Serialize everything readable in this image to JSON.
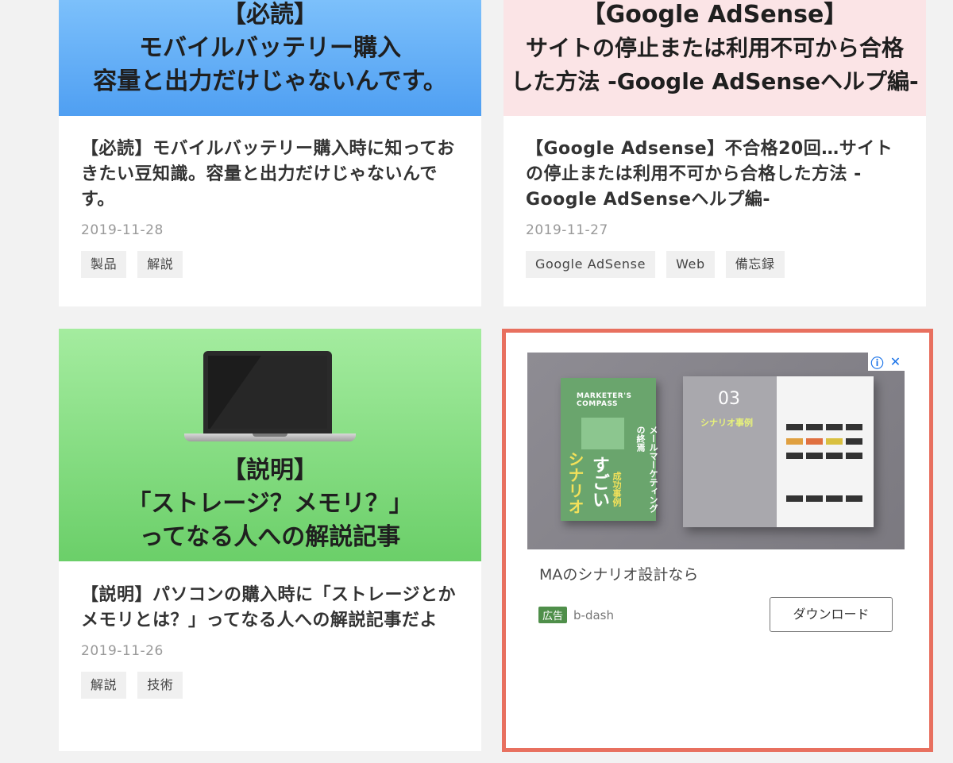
{
  "cards": [
    {
      "thumb_lines": [
        "【必読】",
        "モバイルバッテリー購入",
        "容量と出力だけじゃないんです。"
      ],
      "title": "【必読】モバイルバッテリー購入時に知っておきたい豆知識。容量と出力だけじゃないんです。",
      "date": "2019-11-28",
      "tags": [
        "製品",
        "解説"
      ]
    },
    {
      "thumb_lines": [
        "【Google AdSense】",
        "サイトの停止または利用不可から合格",
        "した方法 -Google AdSenseヘルプ編-"
      ],
      "title": "【Google Adsense】不合格20回…サイトの停止または利用不可から合格した方法 -Google AdSenseヘルプ編-",
      "date": "2019-11-27",
      "tags": [
        "Google AdSense",
        "Web",
        "備忘録"
      ]
    },
    {
      "thumb_lines": [
        "【説明】",
        "「ストレージ？メモリ？」",
        "ってなる人への解説記事"
      ],
      "title": "【説明】パソコンの購入時に「ストレージとかメモリとは？」ってなる人への解説記事だよ",
      "date": "2019-11-26",
      "tags": [
        "解説",
        "技術"
      ]
    }
  ],
  "ad": {
    "book_cover_title": "MARKETER'S COMPASS",
    "book_cover_text_1": "すごい",
    "book_cover_text_2": "シナリオ",
    "book_cover_text_3": "メールマーケティングの終焉",
    "book_cover_text_4": "成功事例",
    "book_chapter_number": "03",
    "book_chapter_title": "シナリオ事例",
    "headline": "MAのシナリオ設計なら",
    "label": "広告",
    "advertiser": "b-dash",
    "cta": "ダウンロード",
    "info_icon": "info-icon",
    "close_icon": "close-icon"
  },
  "colors": {
    "thumb1": "#5ea9f5",
    "thumb2": "#fbe4e6",
    "thumb3": "#7fd97a",
    "ad_border": "#e8705f"
  }
}
